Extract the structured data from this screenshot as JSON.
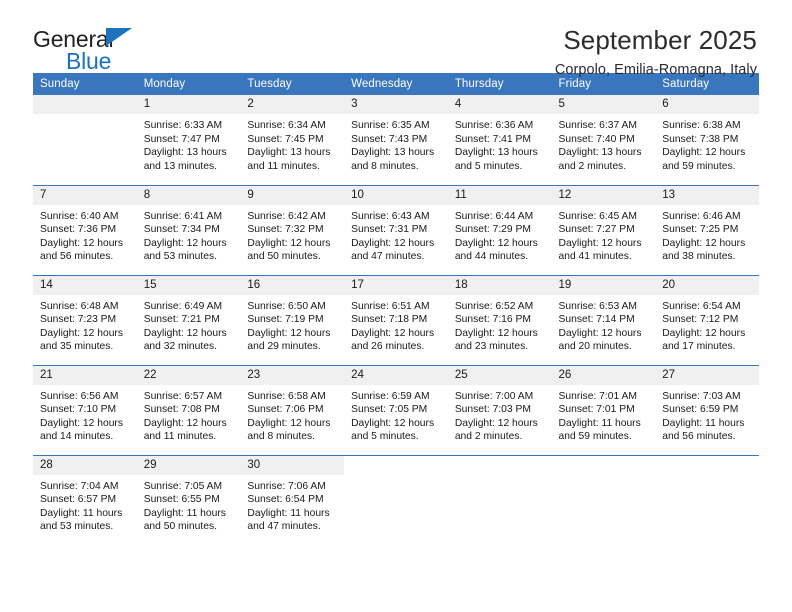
{
  "brand": {
    "name_top": "General",
    "name_bottom": "Blue",
    "accent_color": "#1a73bb"
  },
  "header": {
    "title": "September 2025",
    "subtitle": "Corpolo, Emilia-Romagna, Italy"
  },
  "theme": {
    "header_blue": "#3a76bd",
    "daynum_bg": "#f0f0f0",
    "text": "#1a1a1a"
  },
  "weekday_headers": [
    "Sunday",
    "Monday",
    "Tuesday",
    "Wednesday",
    "Thursday",
    "Friday",
    "Saturday"
  ],
  "weeks": [
    [
      {
        "day": "",
        "empty": true
      },
      {
        "day": "1",
        "sunrise": "Sunrise: 6:33 AM",
        "sunset": "Sunset: 7:47 PM",
        "daylight1": "Daylight: 13 hours",
        "daylight2": "and 13 minutes."
      },
      {
        "day": "2",
        "sunrise": "Sunrise: 6:34 AM",
        "sunset": "Sunset: 7:45 PM",
        "daylight1": "Daylight: 13 hours",
        "daylight2": "and 11 minutes."
      },
      {
        "day": "3",
        "sunrise": "Sunrise: 6:35 AM",
        "sunset": "Sunset: 7:43 PM",
        "daylight1": "Daylight: 13 hours",
        "daylight2": "and 8 minutes."
      },
      {
        "day": "4",
        "sunrise": "Sunrise: 6:36 AM",
        "sunset": "Sunset: 7:41 PM",
        "daylight1": "Daylight: 13 hours",
        "daylight2": "and 5 minutes."
      },
      {
        "day": "5",
        "sunrise": "Sunrise: 6:37 AM",
        "sunset": "Sunset: 7:40 PM",
        "daylight1": "Daylight: 13 hours",
        "daylight2": "and 2 minutes."
      },
      {
        "day": "6",
        "sunrise": "Sunrise: 6:38 AM",
        "sunset": "Sunset: 7:38 PM",
        "daylight1": "Daylight: 12 hours",
        "daylight2": "and 59 minutes."
      }
    ],
    [
      {
        "day": "7",
        "sunrise": "Sunrise: 6:40 AM",
        "sunset": "Sunset: 7:36 PM",
        "daylight1": "Daylight: 12 hours",
        "daylight2": "and 56 minutes."
      },
      {
        "day": "8",
        "sunrise": "Sunrise: 6:41 AM",
        "sunset": "Sunset: 7:34 PM",
        "daylight1": "Daylight: 12 hours",
        "daylight2": "and 53 minutes."
      },
      {
        "day": "9",
        "sunrise": "Sunrise: 6:42 AM",
        "sunset": "Sunset: 7:32 PM",
        "daylight1": "Daylight: 12 hours",
        "daylight2": "and 50 minutes."
      },
      {
        "day": "10",
        "sunrise": "Sunrise: 6:43 AM",
        "sunset": "Sunset: 7:31 PM",
        "daylight1": "Daylight: 12 hours",
        "daylight2": "and 47 minutes."
      },
      {
        "day": "11",
        "sunrise": "Sunrise: 6:44 AM",
        "sunset": "Sunset: 7:29 PM",
        "daylight1": "Daylight: 12 hours",
        "daylight2": "and 44 minutes."
      },
      {
        "day": "12",
        "sunrise": "Sunrise: 6:45 AM",
        "sunset": "Sunset: 7:27 PM",
        "daylight1": "Daylight: 12 hours",
        "daylight2": "and 41 minutes."
      },
      {
        "day": "13",
        "sunrise": "Sunrise: 6:46 AM",
        "sunset": "Sunset: 7:25 PM",
        "daylight1": "Daylight: 12 hours",
        "daylight2": "and 38 minutes."
      }
    ],
    [
      {
        "day": "14",
        "sunrise": "Sunrise: 6:48 AM",
        "sunset": "Sunset: 7:23 PM",
        "daylight1": "Daylight: 12 hours",
        "daylight2": "and 35 minutes."
      },
      {
        "day": "15",
        "sunrise": "Sunrise: 6:49 AM",
        "sunset": "Sunset: 7:21 PM",
        "daylight1": "Daylight: 12 hours",
        "daylight2": "and 32 minutes."
      },
      {
        "day": "16",
        "sunrise": "Sunrise: 6:50 AM",
        "sunset": "Sunset: 7:19 PM",
        "daylight1": "Daylight: 12 hours",
        "daylight2": "and 29 minutes."
      },
      {
        "day": "17",
        "sunrise": "Sunrise: 6:51 AM",
        "sunset": "Sunset: 7:18 PM",
        "daylight1": "Daylight: 12 hours",
        "daylight2": "and 26 minutes."
      },
      {
        "day": "18",
        "sunrise": "Sunrise: 6:52 AM",
        "sunset": "Sunset: 7:16 PM",
        "daylight1": "Daylight: 12 hours",
        "daylight2": "and 23 minutes."
      },
      {
        "day": "19",
        "sunrise": "Sunrise: 6:53 AM",
        "sunset": "Sunset: 7:14 PM",
        "daylight1": "Daylight: 12 hours",
        "daylight2": "and 20 minutes."
      },
      {
        "day": "20",
        "sunrise": "Sunrise: 6:54 AM",
        "sunset": "Sunset: 7:12 PM",
        "daylight1": "Daylight: 12 hours",
        "daylight2": "and 17 minutes."
      }
    ],
    [
      {
        "day": "21",
        "sunrise": "Sunrise: 6:56 AM",
        "sunset": "Sunset: 7:10 PM",
        "daylight1": "Daylight: 12 hours",
        "daylight2": "and 14 minutes."
      },
      {
        "day": "22",
        "sunrise": "Sunrise: 6:57 AM",
        "sunset": "Sunset: 7:08 PM",
        "daylight1": "Daylight: 12 hours",
        "daylight2": "and 11 minutes."
      },
      {
        "day": "23",
        "sunrise": "Sunrise: 6:58 AM",
        "sunset": "Sunset: 7:06 PM",
        "daylight1": "Daylight: 12 hours",
        "daylight2": "and 8 minutes."
      },
      {
        "day": "24",
        "sunrise": "Sunrise: 6:59 AM",
        "sunset": "Sunset: 7:05 PM",
        "daylight1": "Daylight: 12 hours",
        "daylight2": "and 5 minutes."
      },
      {
        "day": "25",
        "sunrise": "Sunrise: 7:00 AM",
        "sunset": "Sunset: 7:03 PM",
        "daylight1": "Daylight: 12 hours",
        "daylight2": "and 2 minutes."
      },
      {
        "day": "26",
        "sunrise": "Sunrise: 7:01 AM",
        "sunset": "Sunset: 7:01 PM",
        "daylight1": "Daylight: 11 hours",
        "daylight2": "and 59 minutes."
      },
      {
        "day": "27",
        "sunrise": "Sunrise: 7:03 AM",
        "sunset": "Sunset: 6:59 PM",
        "daylight1": "Daylight: 11 hours",
        "daylight2": "and 56 minutes."
      }
    ],
    [
      {
        "day": "28",
        "sunrise": "Sunrise: 7:04 AM",
        "sunset": "Sunset: 6:57 PM",
        "daylight1": "Daylight: 11 hours",
        "daylight2": "and 53 minutes."
      },
      {
        "day": "29",
        "sunrise": "Sunrise: 7:05 AM",
        "sunset": "Sunset: 6:55 PM",
        "daylight1": "Daylight: 11 hours",
        "daylight2": "and 50 minutes."
      },
      {
        "day": "30",
        "sunrise": "Sunrise: 7:06 AM",
        "sunset": "Sunset: 6:54 PM",
        "daylight1": "Daylight: 11 hours",
        "daylight2": "and 47 minutes."
      },
      {
        "day": "",
        "empty": true,
        "blank": true
      },
      {
        "day": "",
        "empty": true,
        "blank": true
      },
      {
        "day": "",
        "empty": true,
        "blank": true
      },
      {
        "day": "",
        "empty": true,
        "blank": true
      }
    ]
  ]
}
